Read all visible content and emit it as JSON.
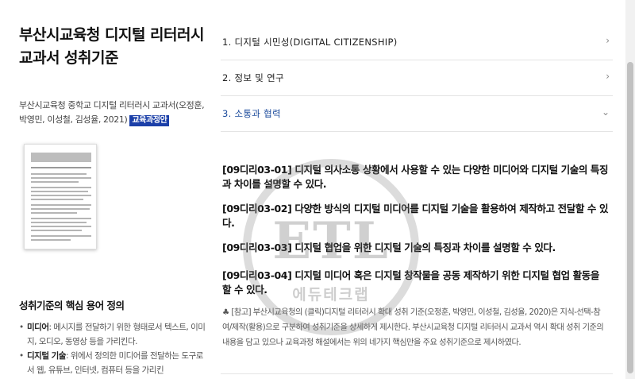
{
  "document": {
    "title": "부산시교육청 디지털 리터러시 교과서 성취기준",
    "meta_text": "부산시교육청 중학교 디지털 리터러시 교과서(오정훈, 박영민, 이성철, 김성율, 2021)",
    "badge": "교육과정안"
  },
  "definitions": {
    "title": "성취기준의 핵심 용어 정의",
    "items": [
      {
        "term": "미디어",
        "desc": ": 메시지를 전달하기 위한 형태로서 텍스트, 이미지, 오디오, 동영상 등을 가리킨다."
      },
      {
        "term": "디지털 기술",
        "desc": ": 위에서 정의한 미디어를 전달하는 도구로서 웹, 유튜브, 인터넷, 컴퓨터 등을 가리킨"
      }
    ]
  },
  "accordion": [
    {
      "label": "1. 디지털 시민성(DIGITAL CITIZENSHIP)",
      "expanded": false
    },
    {
      "label": "2. 정보 및 연구",
      "expanded": false
    },
    {
      "label": "3. 소통과 협력",
      "expanded": true
    }
  ],
  "standards": [
    "[09디리03-01] 디지털 의사소통 상황에서 사용할 수 있는 다양한 미디어와 디지털 기술의 특징과 차이를 설명할 수 있다.",
    "[09디리03-02] 다양한 방식의 디지털 미디어를 디지털 기술을 활용하여 제작하고 전달할 수 있다.",
    "[09디리03-03] 디지털 협업을 위한 디지털 기술의 특징과 차이를 설명할 수 있다.",
    "[09디리03-04] 디지털 미디어 혹은 디지털 창작물을 공동 제작하기 위한 디지털 협업 활동을 할 수 있다."
  ],
  "note": "♣ [참고] 부산시교육청의 (클릭)디지털 리터러시 확대 성취 기준(오정훈, 박영민, 이성철, 김성율, 2020)은 지식-선택-참여/제작(활용)으로 구분하여 성취기준을 상세하게 제시한다. 부산시교육청 디지털 리터러시 교과서 역시 확대 성취 기준의 내용을 담고 있으나 교육과정 해설에서는 위의 네가지 핵심만을 주요 성취기준으로 제시하였다.",
  "watermark": {
    "text": "ETL",
    "subtext": "에듀테크랩"
  },
  "icons": {
    "chevron_collapsed": "›",
    "chevron_expanded": "⌄"
  },
  "colors": {
    "accent": "#1c4b9c",
    "badge_bg": "#1b3fa8"
  }
}
